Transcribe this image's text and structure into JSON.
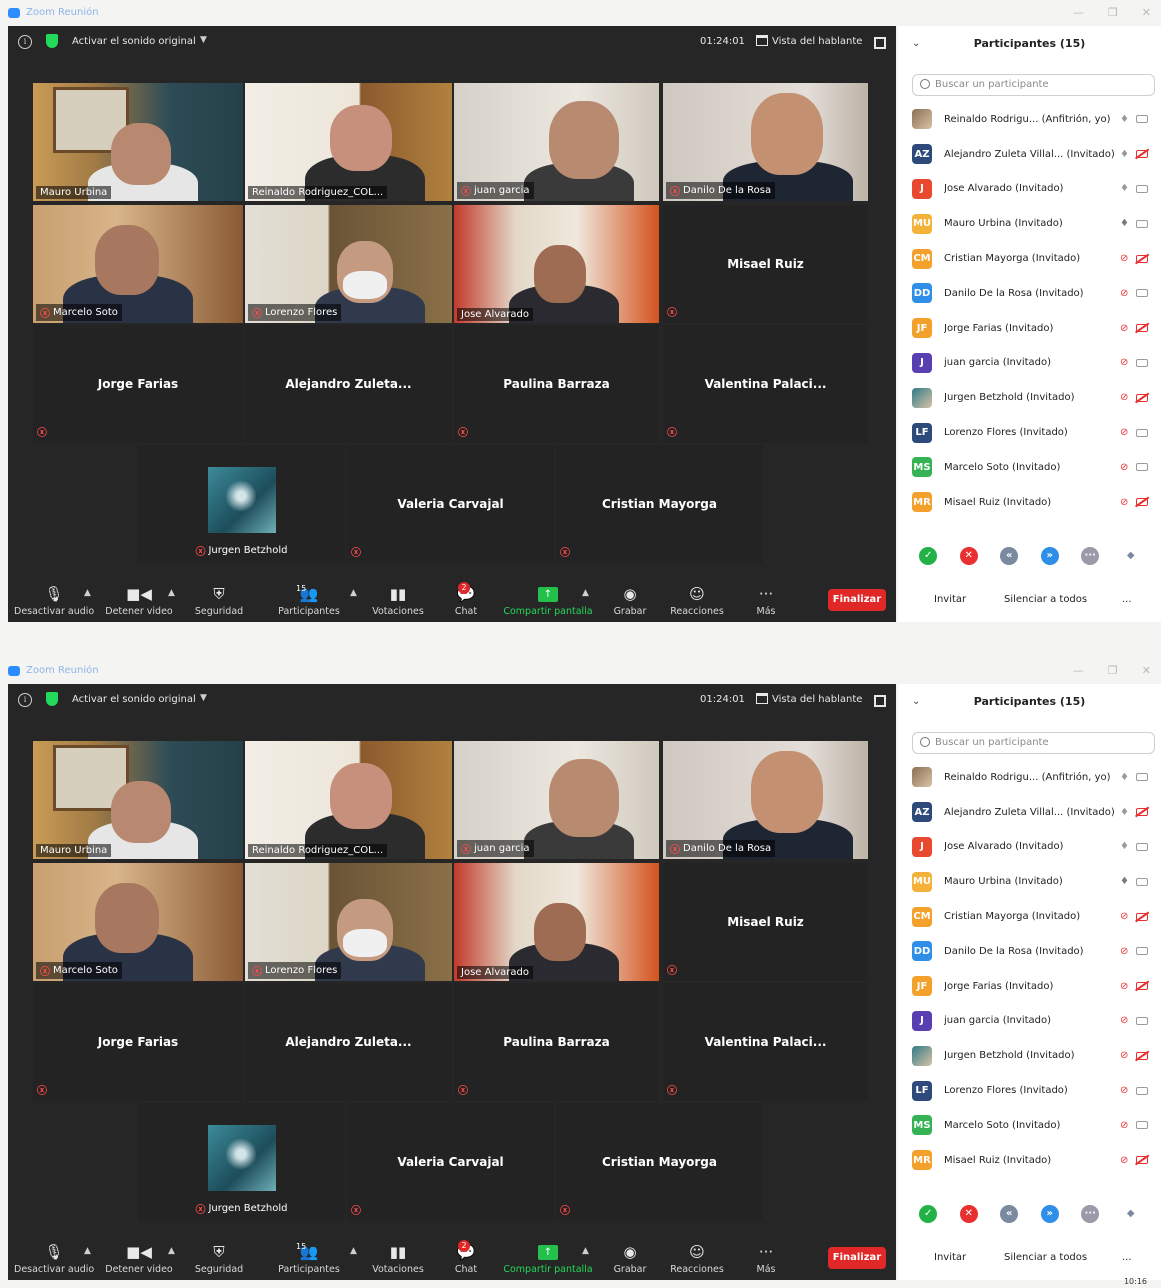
{
  "window": {
    "title": "Zoom Reunión",
    "minimize": "—",
    "restore": "❐",
    "close": "✕"
  },
  "topbar": {
    "original_audio": "Activar el sonido original",
    "timer": "01:24:01",
    "view": "Vista del hablante"
  },
  "tiles": {
    "mauro": "Mauro Urbina",
    "reinaldo": "Reinaldo Rodriguez_COL...",
    "juan": "juan garcia",
    "danilo": "Danilo De la Rosa",
    "marcelo": "Marcelo Soto",
    "lorenzo": "Lorenzo Flores",
    "jose": "Jose Alvarado",
    "misael": "Misael Ruiz",
    "jorge": "Jorge Farias",
    "alejandro": "Alejandro Zuleta...",
    "paulina": "Paulina Barraza",
    "valentina": "Valentina Palaci...",
    "jurgen": "Jurgen Betzhold",
    "valeria": "Valeria Carvajal",
    "cristian": "Cristian Mayorga"
  },
  "toolbar": {
    "audio": "Desactivar audio",
    "video": "Detener video",
    "security": "Seguridad",
    "participants": "Participantes",
    "participants_count": "15",
    "polls": "Votaciones",
    "chat": "Chat",
    "chat_badge": "2",
    "share": "Compartir pantalla",
    "record": "Grabar",
    "reactions": "Reacciones",
    "more": "Más",
    "end": "Finalizar"
  },
  "panel": {
    "title": "Participantes (15)",
    "search_placeholder": "Buscar un participante",
    "participants": [
      {
        "initials": "",
        "name": "Reinaldo Rodrigu... (Anfitrión, yo)",
        "color": "#8a6f55",
        "photo": true
      },
      {
        "initials": "AZ",
        "name": "Alejandro Zuleta Villal... (Invitado)",
        "color": "#2e4a7a"
      },
      {
        "initials": "J",
        "name": "Jose Alvarado (Invitado)",
        "color": "#e8492f"
      },
      {
        "initials": "MU",
        "name": "Mauro Urbina (Invitado)",
        "color": "#f4b23a"
      },
      {
        "initials": "CM",
        "name": "Cristian Mayorga (Invitado)",
        "color": "#f3a12a"
      },
      {
        "initials": "DD",
        "name": "Danilo De la Rosa (Invitado)",
        "color": "#2f8ee8"
      },
      {
        "initials": "JF",
        "name": "Jorge Farias (Invitado)",
        "color": "#f3a12a"
      },
      {
        "initials": "J",
        "name": "juan garcia (Invitado)",
        "color": "#5a3fb3"
      },
      {
        "initials": "",
        "name": "Jurgen Betzhold (Invitado)",
        "color": "#2f7a86",
        "photo": true
      },
      {
        "initials": "LF",
        "name": "Lorenzo Flores (Invitado)",
        "color": "#2e4a7a"
      },
      {
        "initials": "MS",
        "name": "Marcelo Soto (Invitado)",
        "color": "#35b354"
      },
      {
        "initials": "MR",
        "name": "Misael Ruiz (Invitado)",
        "color": "#f3a12a"
      }
    ],
    "invite": "Invitar",
    "mute_all": "Silenciar a todos",
    "more": "..."
  },
  "taskbar": {
    "time": "10:16"
  }
}
